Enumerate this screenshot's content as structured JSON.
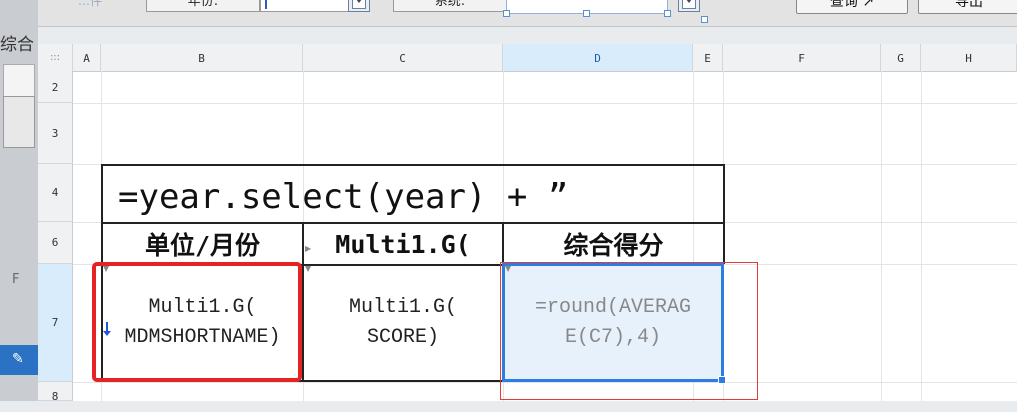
{
  "toolbar": {
    "condition_label": "…件",
    "year_label": "年份:",
    "system_label": "系统:",
    "query_button": "查询",
    "export_button": "导出"
  },
  "left_panel": {
    "title_fragment": "综合",
    "side_label": "F"
  },
  "grid": {
    "corner": ":::",
    "columns": [
      {
        "id": "A",
        "selected": false
      },
      {
        "id": "B",
        "selected": false
      },
      {
        "id": "C",
        "selected": false
      },
      {
        "id": "D",
        "selected": true
      },
      {
        "id": "E",
        "selected": false
      },
      {
        "id": "F",
        "selected": false
      },
      {
        "id": "G",
        "selected": false
      },
      {
        "id": "H",
        "selected": false
      }
    ],
    "rows": [
      "2",
      "3",
      "4",
      "6",
      "7",
      "8"
    ],
    "selected_row": "7"
  },
  "cells": {
    "title_formula": "=year.select(year) + ”",
    "header_unit_month": "单位/月份",
    "header_multi": "Multi1.G(",
    "header_score": "综合得分",
    "b7_line1": "Multi1.G(",
    "b7_line2": "MDMSHORTNAME)",
    "c7_line1": "Multi1.G(",
    "c7_line2": "SCORE)",
    "d7_line1": "=round(AVERAG",
    "d7_line2": "E(C7),4)"
  },
  "colors": {
    "selection_blue": "#2b7de1",
    "highlight_red": "#e52323",
    "header_selected": "#d9ecfb"
  }
}
